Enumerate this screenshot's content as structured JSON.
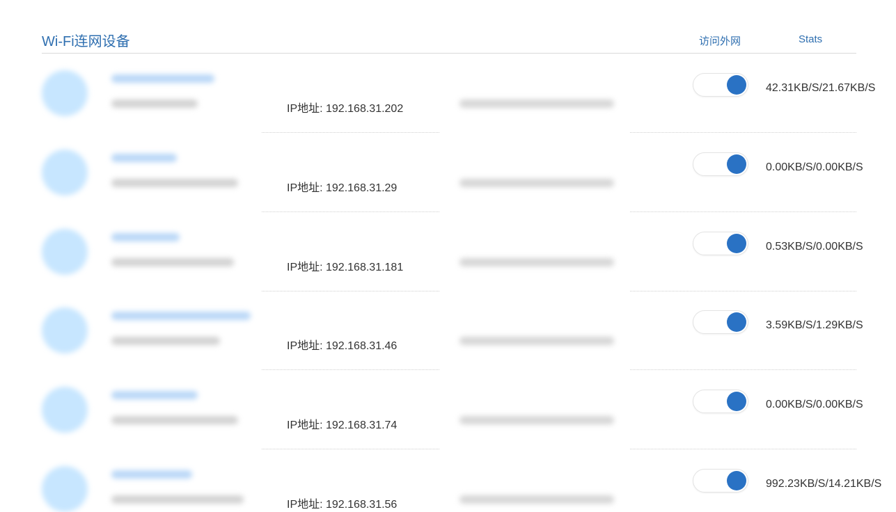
{
  "header": {
    "title": "Wi-Fi连网设备",
    "col_access": "访问外网",
    "col_stats": "Stats"
  },
  "colors": {
    "accent": "#2f6fb0",
    "toggle_on": "#2a72c4",
    "avatar": "#c7e6ff"
  },
  "devices": [
    {
      "ip": "IP地址: 192.168.31.202",
      "stats": "42.31KB/S/21.67KB/S",
      "access_enabled": true
    },
    {
      "ip": "IP地址: 192.168.31.29",
      "stats": "0.00KB/S/0.00KB/S",
      "access_enabled": true
    },
    {
      "ip": "IP地址: 192.168.31.181",
      "stats": "0.53KB/S/0.00KB/S",
      "access_enabled": true
    },
    {
      "ip": "IP地址: 192.168.31.46",
      "stats": "3.59KB/S/1.29KB/S",
      "access_enabled": true
    },
    {
      "ip": "IP地址: 192.168.31.74",
      "stats": "0.00KB/S/0.00KB/S",
      "access_enabled": true
    },
    {
      "ip": "IP地址: 192.168.31.56",
      "stats": "992.23KB/S/14.21KB/S",
      "access_enabled": true
    }
  ]
}
